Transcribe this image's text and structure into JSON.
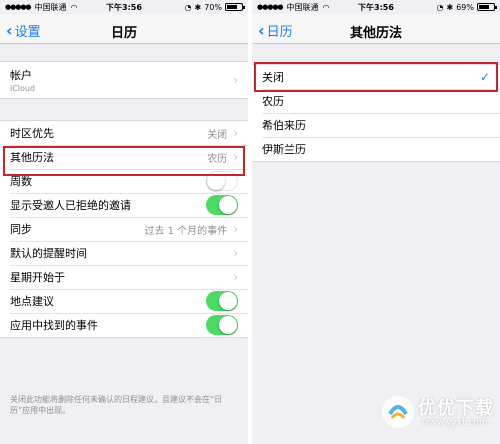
{
  "left": {
    "status": {
      "carrier": "中国联通",
      "time": "下午3:56",
      "battery": "70%",
      "battery_level": 0.7
    },
    "nav": {
      "back_label": "设置",
      "title": "日历"
    },
    "account": {
      "label": "帐户",
      "sub": "iCloud"
    },
    "rows": {
      "time_zone": {
        "label": "时区优先",
        "detail": "关闭"
      },
      "other_calendars": {
        "label": "其他历法",
        "detail": "农历"
      },
      "week_numbers": {
        "label": "周数",
        "on": false
      },
      "show_declined": {
        "label": "显示受邀人已拒绝的邀请",
        "on": true
      },
      "sync": {
        "label": "同步",
        "detail": "过去 1 个月的事件"
      },
      "default_alert": {
        "label": "默认的提醒时间"
      },
      "week_start": {
        "label": "星期开始于"
      },
      "location_suggestions": {
        "label": "地点建议",
        "on": true
      },
      "events_found_in_apps": {
        "label": "应用中找到的事件",
        "on": true
      }
    },
    "footer": "关闭此功能将删除任何未确认的日程建议，且建议不会在“日历”应用中出现。"
  },
  "right": {
    "status": {
      "carrier": "中国联通",
      "time": "下午3:56",
      "battery": "69%",
      "battery_level": 0.69
    },
    "nav": {
      "back_label": "日历",
      "title": "其他历法"
    },
    "options": [
      {
        "label": "关闭",
        "selected": true
      },
      {
        "label": "农历",
        "selected": false
      },
      {
        "label": "希伯来历",
        "selected": false
      },
      {
        "label": "伊斯兰历",
        "selected": false
      }
    ]
  },
  "watermark": {
    "text": "优优下载",
    "url": "www.yyxt.com"
  },
  "colors": {
    "accent": "#147efb",
    "switch_on": "#4cd964",
    "highlight": "#c1272d",
    "background": "#efeff4"
  }
}
